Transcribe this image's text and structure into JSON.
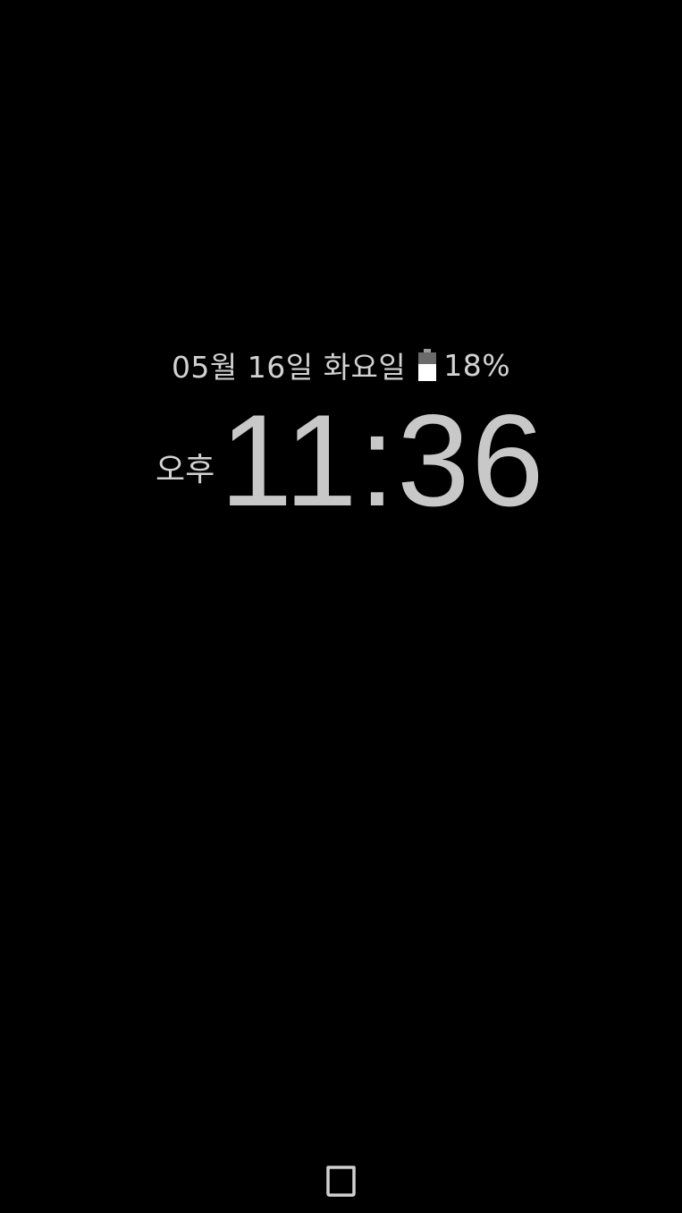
{
  "status": {
    "date": "05월 16일 화요일",
    "battery_percent": "18%",
    "battery_level": 0.6
  },
  "clock": {
    "ampm": "오후",
    "time": "11:36"
  },
  "navigation": {
    "home_icon": "home-square-icon"
  },
  "colors": {
    "background": "#000000",
    "text": "#cfcfcf"
  }
}
